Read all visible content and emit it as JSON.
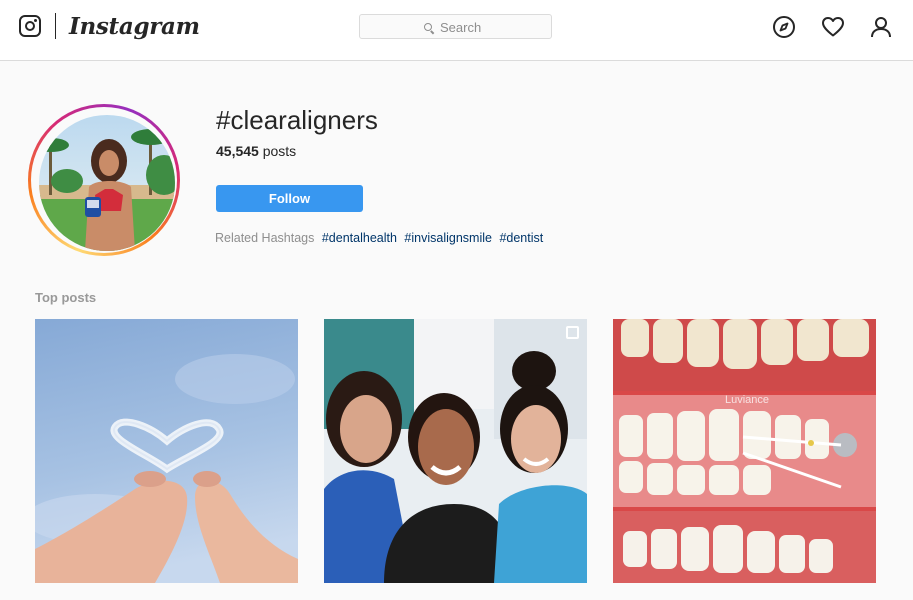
{
  "header": {
    "brand": "Instagram",
    "search_placeholder": "Search",
    "nav_icons": [
      "explore-compass-icon",
      "activity-heart-icon",
      "profile-person-icon"
    ]
  },
  "hashtag": {
    "title": "#clearaligners",
    "post_count": "45,545",
    "post_count_label": "posts",
    "follow_label": "Follow",
    "related_label": "Related Hashtags",
    "related": [
      "#dentalhealth",
      "#invisalignsmile",
      "#dentist"
    ]
  },
  "top_posts": {
    "label": "Top posts",
    "posts": [
      {
        "content": "hands holding heart-shaped clear aligner against blue sky"
      },
      {
        "content": "three smiling women in a dental clinic selfie",
        "icon": "multiple-posts-icon"
      },
      {
        "content": "close-ups of teeth with aligner attachments",
        "watermark": "Luviance"
      }
    ]
  },
  "colors": {
    "accent": "#3897f0",
    "link": "#003569",
    "muted": "#8e8e8e",
    "border": "#dbdbdb",
    "background": "#fafafa"
  }
}
